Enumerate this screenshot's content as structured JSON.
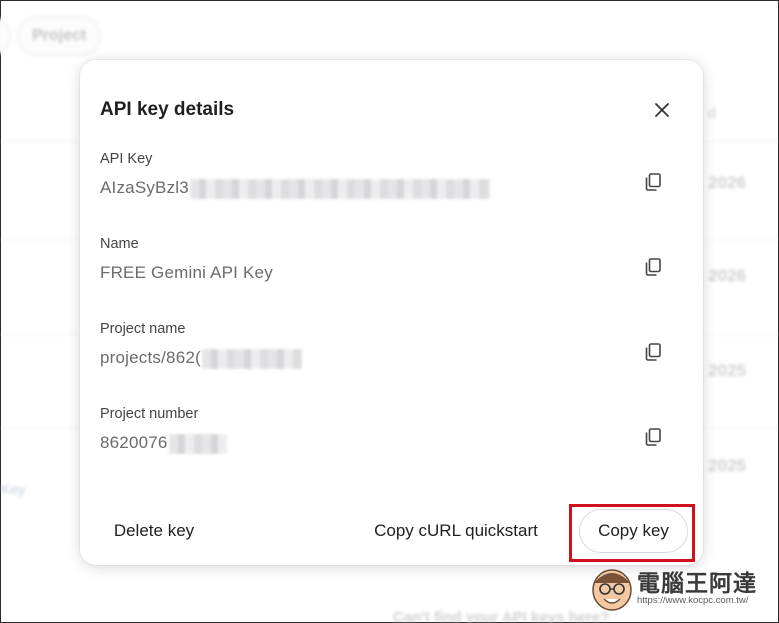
{
  "background": {
    "chip_label": "Project",
    "column_header": "d",
    "dates": [
      ", 2026",
      ", 2026",
      ", 2025",
      ", 2025"
    ],
    "left_link": "Key",
    "bottom_text": "Can't find your API keys here?"
  },
  "dialog": {
    "title": "API key details",
    "fields": [
      {
        "label": "API Key",
        "value": "AIzaSyBzl3"
      },
      {
        "label": "Name",
        "value": "FREE Gemini API Key"
      },
      {
        "label": "Project name",
        "value": "projects/862("
      },
      {
        "label": "Project number",
        "value": "8620076"
      }
    ],
    "redacted_fraction": [
      0.52,
      0,
      0.18,
      0.1
    ],
    "buttons": {
      "delete": "Delete key",
      "curl": "Copy cURL quickstart",
      "copy_key": "Copy key"
    }
  },
  "watermark": {
    "title": "電腦王阿達",
    "url": "https://www.kocpc.com.tw/"
  },
  "colors": {
    "highlight": "#d0101d",
    "text_primary": "#1f1f1f",
    "text_secondary": "#6b6b70"
  }
}
